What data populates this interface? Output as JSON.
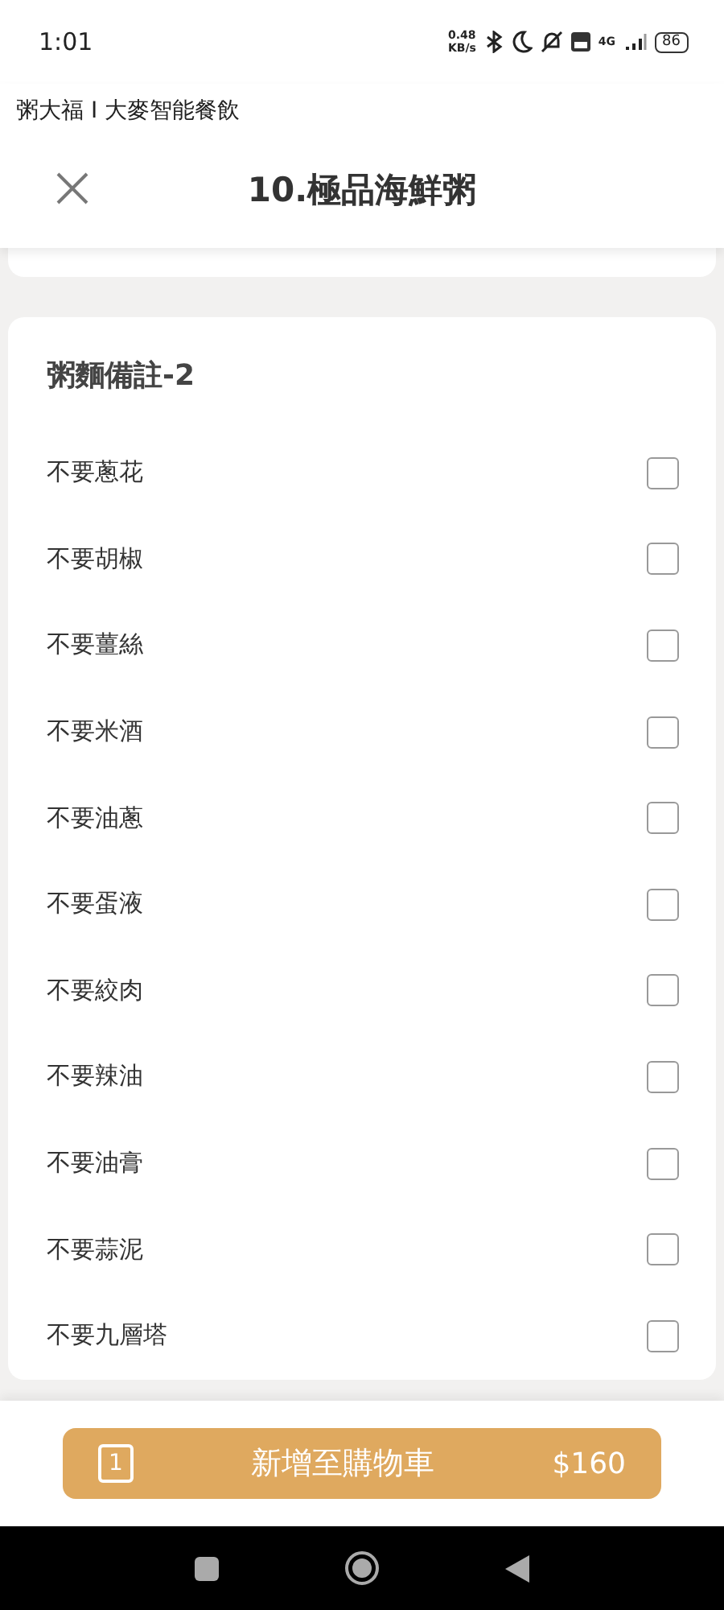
{
  "status_bar": {
    "time": "1:01",
    "speed": "0.48",
    "speed_unit": "KB/s",
    "network": "4G",
    "battery": "86"
  },
  "app_name": "粥大福 I 大麥智能餐飲",
  "header": {
    "title": "10.極品海鮮粥"
  },
  "section": {
    "title": "粥麵備註-2",
    "options": [
      {
        "label": "不要蔥花",
        "checked": false
      },
      {
        "label": "不要胡椒",
        "checked": false
      },
      {
        "label": "不要薑絲",
        "checked": false
      },
      {
        "label": "不要米酒",
        "checked": false
      },
      {
        "label": "不要油蔥",
        "checked": false
      },
      {
        "label": "不要蛋液",
        "checked": false
      },
      {
        "label": "不要絞肉",
        "checked": false
      },
      {
        "label": "不要辣油",
        "checked": false
      },
      {
        "label": "不要油膏",
        "checked": false
      },
      {
        "label": "不要蒜泥",
        "checked": false
      },
      {
        "label": "不要九層塔",
        "checked": false
      }
    ]
  },
  "cart_button": {
    "quantity": "1",
    "label": "新增至購物車",
    "price": "$160"
  }
}
